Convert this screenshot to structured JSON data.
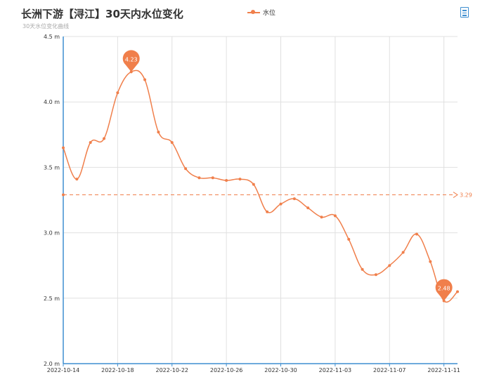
{
  "header": {
    "title": "长洲下游【浔江】30天内水位变化",
    "subtitle": "30天水位变化曲线",
    "legend_label": "水位"
  },
  "icons": {
    "toolbox": "data-view-icon"
  },
  "colors": {
    "series": "#f07f4b",
    "axis": "#3e8ed0",
    "grid": "#e0e0e0",
    "text": "#333333"
  },
  "chart_data": {
    "type": "line",
    "title": "长洲下游【浔江】30天内水位变化",
    "subtitle": "30天水位变化曲线",
    "x_ticks": [
      "2022-10-14",
      "2022-10-18",
      "2022-10-22",
      "2022-10-26",
      "2022-10-30",
      "2022-11-03",
      "2022-11-07",
      "2022-11-11"
    ],
    "y_ticks": [
      "2.0 m",
      "2.5 m",
      "3.0 m",
      "3.5 m",
      "4.0 m",
      "4.5 m"
    ],
    "ylim": [
      2.0,
      4.5
    ],
    "grid": true,
    "legend_position": "top-center",
    "series": [
      {
        "name": "水位",
        "x": [
          "2022-10-14",
          "2022-10-15",
          "2022-10-16",
          "2022-10-17",
          "2022-10-18",
          "2022-10-19",
          "2022-10-20",
          "2022-10-21",
          "2022-10-22",
          "2022-10-23",
          "2022-10-24",
          "2022-10-25",
          "2022-10-26",
          "2022-10-27",
          "2022-10-28",
          "2022-10-29",
          "2022-10-30",
          "2022-10-31",
          "2022-11-01",
          "2022-11-02",
          "2022-11-03",
          "2022-11-04",
          "2022-11-05",
          "2022-11-06",
          "2022-11-07",
          "2022-11-08",
          "2022-11-09",
          "2022-11-10",
          "2022-11-11",
          "2022-11-12"
        ],
        "values": [
          3.65,
          3.41,
          3.69,
          3.72,
          4.07,
          4.23,
          4.17,
          3.77,
          3.69,
          3.49,
          3.42,
          3.42,
          3.4,
          3.41,
          3.37,
          3.16,
          3.22,
          3.26,
          3.19,
          3.12,
          3.13,
          2.95,
          2.72,
          2.68,
          2.75,
          2.85,
          2.99,
          2.78,
          2.48,
          2.55
        ]
      }
    ],
    "mark_points": [
      {
        "type": "max",
        "label": "4.23",
        "index": 5
      },
      {
        "type": "min",
        "label": "2.48",
        "index": 28
      }
    ],
    "mark_line": {
      "type": "average",
      "value": 3.29,
      "label": "3.29"
    }
  }
}
